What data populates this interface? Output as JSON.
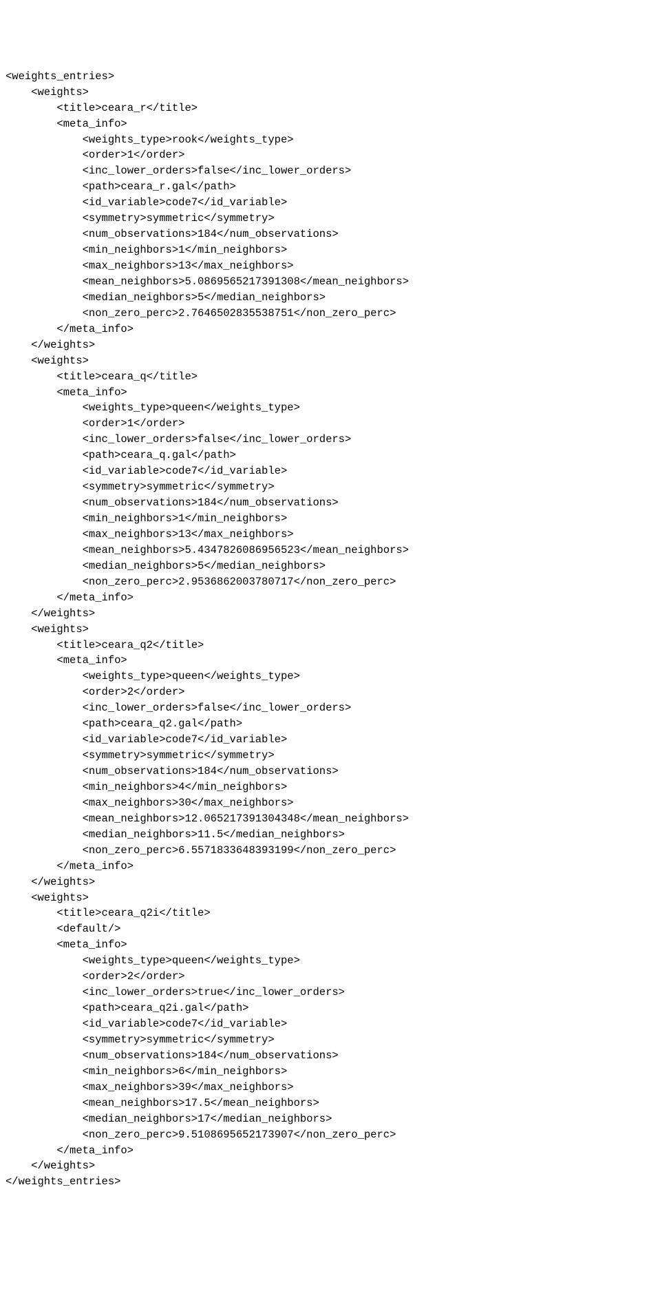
{
  "root_tag": "weights_entries",
  "entries": [
    {
      "title": "ceara_r",
      "default": false,
      "meta": {
        "weights_type": "rook",
        "order": "1",
        "inc_lower_orders": "false",
        "path": "ceara_r.gal",
        "id_variable": "code7",
        "symmetry": "symmetric",
        "num_observations": "184",
        "min_neighbors": "1",
        "max_neighbors": "13",
        "mean_neighbors": "5.0869565217391308",
        "median_neighbors": "5",
        "non_zero_perc": "2.7646502835538751"
      }
    },
    {
      "title": "ceara_q",
      "default": false,
      "meta": {
        "weights_type": "queen",
        "order": "1",
        "inc_lower_orders": "false",
        "path": "ceara_q.gal",
        "id_variable": "code7",
        "symmetry": "symmetric",
        "num_observations": "184",
        "min_neighbors": "1",
        "max_neighbors": "13",
        "mean_neighbors": "5.4347826086956523",
        "median_neighbors": "5",
        "non_zero_perc": "2.9536862003780717"
      }
    },
    {
      "title": "ceara_q2",
      "default": false,
      "meta": {
        "weights_type": "queen",
        "order": "2",
        "inc_lower_orders": "false",
        "path": "ceara_q2.gal",
        "id_variable": "code7",
        "symmetry": "symmetric",
        "num_observations": "184",
        "min_neighbors": "4",
        "max_neighbors": "30",
        "mean_neighbors": "12.065217391304348",
        "median_neighbors": "11.5",
        "non_zero_perc": "6.5571833648393199"
      }
    },
    {
      "title": "ceara_q2i",
      "default": true,
      "meta": {
        "weights_type": "queen",
        "order": "2",
        "inc_lower_orders": "true",
        "path": "ceara_q2i.gal",
        "id_variable": "code7",
        "symmetry": "symmetric",
        "num_observations": "184",
        "min_neighbors": "6",
        "max_neighbors": "39",
        "mean_neighbors": "17.5",
        "median_neighbors": "17",
        "non_zero_perc": "9.5108695652173907"
      }
    }
  ],
  "indent": "    "
}
